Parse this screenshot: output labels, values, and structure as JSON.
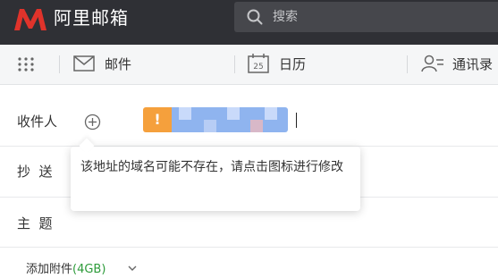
{
  "app": {
    "brand": "阿里邮箱",
    "brand_color": "#e0332b"
  },
  "search": {
    "placeholder": "搜索",
    "icon": "search-icon"
  },
  "nav": {
    "items": [
      {
        "label": "邮件",
        "icon": "mail-icon"
      },
      {
        "label": "日历",
        "icon": "calendar-icon",
        "icon_text": "25"
      },
      {
        "label": "通讯录",
        "icon": "contacts-icon"
      }
    ],
    "apps_icon": "grid-icon"
  },
  "compose": {
    "to_label": "收件人",
    "add_icon": "plus-circle-icon",
    "recipient": {
      "warning_mark": "!",
      "value": "",
      "status_color": "#f5a03c"
    },
    "cc_label": "抄  送",
    "subject_label": "主  题",
    "attach_label": "添加附件",
    "attach_size": "(4GB)"
  },
  "tooltip": {
    "text": "该地址的域名可能不存在，请点击图标进行修改"
  }
}
